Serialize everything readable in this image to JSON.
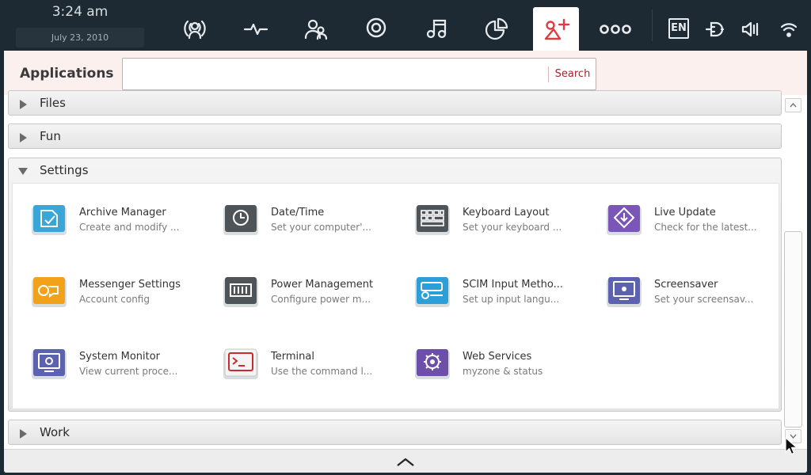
{
  "clock": {
    "time": "3:24 am",
    "date": "July 23, 2010"
  },
  "toolbar": {
    "zones": [
      {
        "name": "status",
        "icon": "broadcast-person-icon"
      },
      {
        "name": "pasteboard",
        "icon": "pulse-icon"
      },
      {
        "name": "people",
        "icon": "people-icon"
      },
      {
        "name": "internet",
        "icon": "target-icon"
      },
      {
        "name": "media",
        "icon": "music-note-icon"
      },
      {
        "name": "zones",
        "icon": "pie-icon"
      },
      {
        "name": "applications",
        "icon": "applications-plus-icon",
        "active": true
      },
      {
        "name": "devices",
        "icon": "three-circles-icon"
      }
    ],
    "tray": {
      "language": "EN"
    }
  },
  "window": {
    "title": "Applications",
    "search": {
      "value": "",
      "placeholder": "",
      "button": "Search"
    },
    "categories": [
      {
        "label": "Files",
        "expanded": false
      },
      {
        "label": "Fun",
        "expanded": false
      },
      {
        "label": "Settings",
        "expanded": true
      },
      {
        "label": "Work",
        "expanded": false
      }
    ],
    "apps": [
      {
        "name": "Archive Manager",
        "desc": "Create and modify ...",
        "color": "#3aa6d8"
      },
      {
        "name": "Date/Time",
        "desc": "Set your computer'...",
        "color": "#4e5458"
      },
      {
        "name": "Keyboard Layout",
        "desc": "Set your keyboard ...",
        "color": "#4e5458"
      },
      {
        "name": "Live Update",
        "desc": "Check for the latest...",
        "color": "#7a56b8"
      },
      {
        "name": "Messenger Settings",
        "desc": "Account config",
        "color": "#f2a21a"
      },
      {
        "name": "Power Management",
        "desc": "Configure power m...",
        "color": "#4e5458"
      },
      {
        "name": "SCIM Input Metho...",
        "desc": "Set up input langu...",
        "color": "#2d9fd8"
      },
      {
        "name": "Screensaver",
        "desc": "Set your screensav...",
        "color": "#5d62b0"
      },
      {
        "name": "System Monitor",
        "desc": "View current proce...",
        "color": "#5d62b0"
      },
      {
        "name": "Terminal",
        "desc": "Use the command l...",
        "color": "#cc2a31"
      },
      {
        "name": "Web Services",
        "desc": "myzone & status",
        "color": "#6d4ea8"
      }
    ]
  },
  "colors": {
    "panel": "#1e2a33",
    "accent": "#e03a45",
    "header_bg": "#fcf0ef"
  }
}
